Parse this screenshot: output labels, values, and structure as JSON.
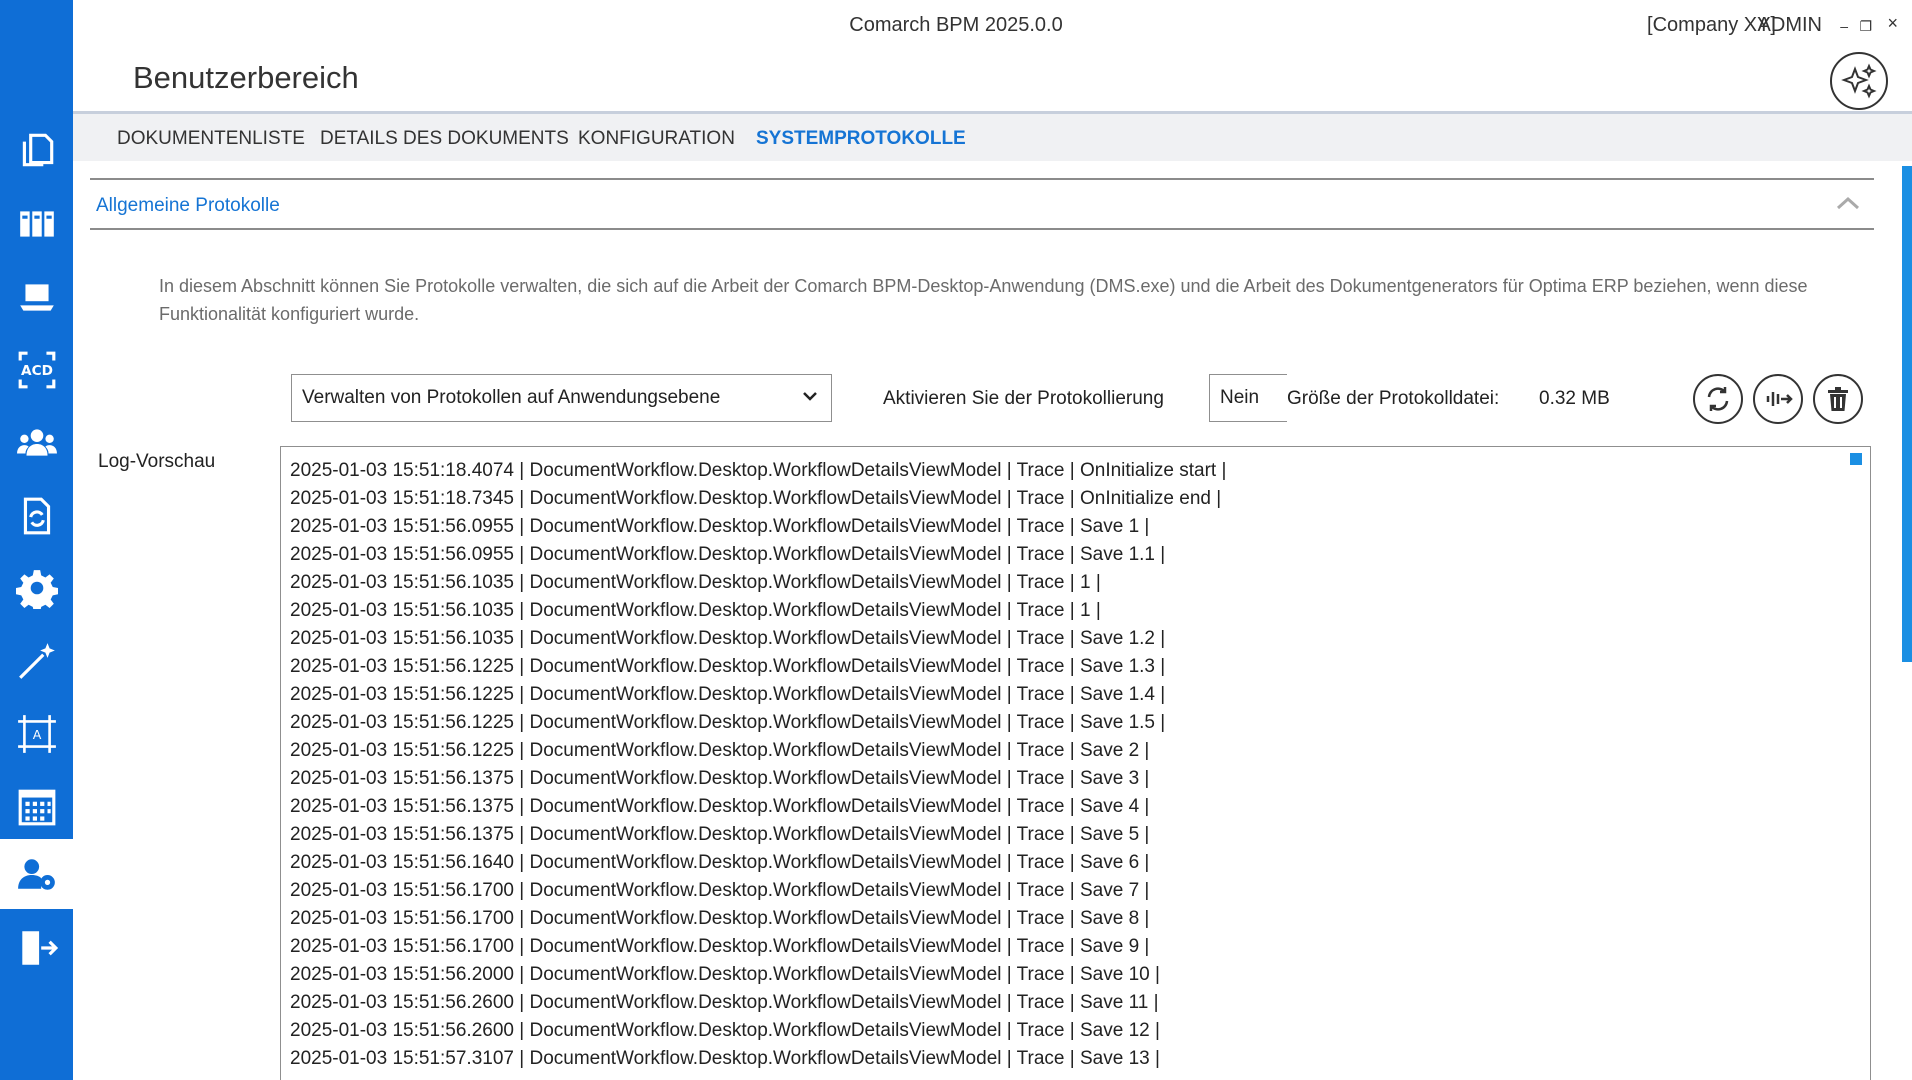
{
  "window": {
    "title": "Comarch BPM 2025.0.0",
    "company": "[Company XY]",
    "user": "ADMIN",
    "controls": {
      "minimize": "–",
      "maximize": "❐",
      "close": "×"
    }
  },
  "page": {
    "title": "Benutzerbereich"
  },
  "colors": {
    "accent": "#1574d4",
    "sidebar": "#0f6ed6"
  },
  "sidebar": {
    "items": [
      {
        "name": "documents-icon",
        "active": false
      },
      {
        "name": "binders-icon",
        "active": false
      },
      {
        "name": "laptop-icon",
        "active": false
      },
      {
        "name": "ocr-acd-icon",
        "active": false
      },
      {
        "name": "users-group-icon",
        "active": false
      },
      {
        "name": "document-sync-icon",
        "active": false
      },
      {
        "name": "gear-icon",
        "active": false
      },
      {
        "name": "magic-wand-icon",
        "active": false
      },
      {
        "name": "template-designer-icon",
        "active": false
      },
      {
        "name": "calendar-icon",
        "active": false
      },
      {
        "name": "user-settings-icon",
        "active": true
      },
      {
        "name": "logout-icon",
        "active": false
      }
    ]
  },
  "tabs": [
    {
      "label": "DOKUMENTENLISTE",
      "active": false
    },
    {
      "label": "DETAILS DES DOKUMENTS",
      "active": false
    },
    {
      "label": "KONFIGURATION",
      "active": false
    },
    {
      "label": "SYSTEMPROTOKOLLE",
      "active": true
    }
  ],
  "section": {
    "title": "Allgemeine Protokolle",
    "description": "In diesem Abschnitt können Sie Protokolle verwalten, die sich auf die Arbeit der Comarch BPM-Desktop-Anwendung (DMS.exe) und die Arbeit des Dokumentgenerators für Optima ERP beziehen, wenn diese Funktionalität konfiguriert wurde."
  },
  "controls": {
    "level_select": "Verwalten von Protokollen auf Anwendungsebene",
    "enable_label": "Aktivieren Sie der Protokollierung",
    "enable_value": "Nein",
    "size_label": "Größe der Protokolldatei:",
    "size_value": "0.32 MB"
  },
  "log": {
    "label": "Log-Vorschau",
    "lines": [
      "2025-01-03 15:51:18.4074 | DocumentWorkflow.Desktop.WorkflowDetailsViewModel | Trace | OnInitialize start |",
      "2025-01-03 15:51:18.7345 | DocumentWorkflow.Desktop.WorkflowDetailsViewModel | Trace | OnInitialize end |",
      "2025-01-03 15:51:56.0955 | DocumentWorkflow.Desktop.WorkflowDetailsViewModel | Trace | Save 1 |",
      "2025-01-03 15:51:56.0955 | DocumentWorkflow.Desktop.WorkflowDetailsViewModel | Trace | Save 1.1 |",
      "2025-01-03 15:51:56.1035 | DocumentWorkflow.Desktop.WorkflowDetailsViewModel | Trace | 1 |",
      "2025-01-03 15:51:56.1035 | DocumentWorkflow.Desktop.WorkflowDetailsViewModel | Trace | 1 |",
      "2025-01-03 15:51:56.1035 | DocumentWorkflow.Desktop.WorkflowDetailsViewModel | Trace | Save 1.2 |",
      "2025-01-03 15:51:56.1225 | DocumentWorkflow.Desktop.WorkflowDetailsViewModel | Trace | Save 1.3 |",
      "2025-01-03 15:51:56.1225 | DocumentWorkflow.Desktop.WorkflowDetailsViewModel | Trace | Save 1.4 |",
      "2025-01-03 15:51:56.1225 | DocumentWorkflow.Desktop.WorkflowDetailsViewModel | Trace | Save 1.5 |",
      "2025-01-03 15:51:56.1225 | DocumentWorkflow.Desktop.WorkflowDetailsViewModel | Trace | Save 2 |",
      "2025-01-03 15:51:56.1375 | DocumentWorkflow.Desktop.WorkflowDetailsViewModel | Trace | Save 3 |",
      "2025-01-03 15:51:56.1375 | DocumentWorkflow.Desktop.WorkflowDetailsViewModel | Trace | Save 4 |",
      "2025-01-03 15:51:56.1375 | DocumentWorkflow.Desktop.WorkflowDetailsViewModel | Trace | Save 5 |",
      "2025-01-03 15:51:56.1640 | DocumentWorkflow.Desktop.WorkflowDetailsViewModel | Trace | Save 6 |",
      "2025-01-03 15:51:56.1700 | DocumentWorkflow.Desktop.WorkflowDetailsViewModel | Trace | Save 7 |",
      "2025-01-03 15:51:56.1700 | DocumentWorkflow.Desktop.WorkflowDetailsViewModel | Trace | Save 8 |",
      "2025-01-03 15:51:56.1700 | DocumentWorkflow.Desktop.WorkflowDetailsViewModel | Trace | Save 9 |",
      "2025-01-03 15:51:56.2000 | DocumentWorkflow.Desktop.WorkflowDetailsViewModel | Trace | Save 10 |",
      "2025-01-03 15:51:56.2600 | DocumentWorkflow.Desktop.WorkflowDetailsViewModel | Trace | Save 11 |",
      "2025-01-03 15:51:56.2600 | DocumentWorkflow.Desktop.WorkflowDetailsViewModel | Trace | Save 12 |",
      "2025-01-03 15:51:57.3107 | DocumentWorkflow.Desktop.WorkflowDetailsViewModel | Trace | Save 13 |"
    ]
  }
}
